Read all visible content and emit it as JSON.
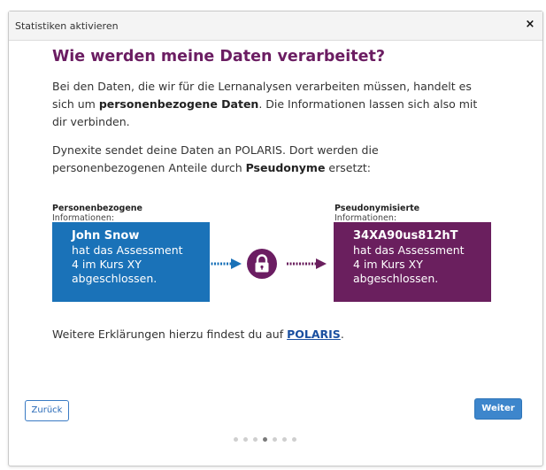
{
  "dialog": {
    "title": "Statistiken aktivieren",
    "close_symbol": "×"
  },
  "content": {
    "heading": "Wie werden meine Daten verarbeitet?",
    "p1_a": "Bei den Daten, die wir für die Lernanalysen verarbeiten müssen, handelt es sich um ",
    "p1_bold": "personenbezogene Daten",
    "p1_b": ". Die Informationen lassen sich also mit dir verbinden.",
    "p2_a": "Dynexite sendet deine Daten an POLARIS. Dort werden die personenbezogenen Anteile durch ",
    "p2_bold": "Pseudonyme",
    "p2_b": " ersetzt:",
    "p3_a": "Weitere Erklärungen hierzu findest du auf ",
    "p3_link": "POLARIS",
    "p3_b": "."
  },
  "left_box": {
    "label_line1": "Personenbezogene",
    "label_line2": "Informationen:",
    "name": "John Snow",
    "line2": "hat das Assessment",
    "line3": "4 im Kurs XY",
    "line4": "abgeschlossen."
  },
  "right_box": {
    "label_line1": "Pseudonymisierte",
    "label_line2": "Informationen:",
    "pseudonym": "34XA90us812hT",
    "line2": "hat das Assessment",
    "line3": "4 im Kurs XY",
    "line4": "abgeschlossen."
  },
  "footer": {
    "back_label": "Zurück",
    "next_label": "Weiter",
    "pager": {
      "total": 7,
      "active": 4
    }
  },
  "colors": {
    "heading": "#6b1d62",
    "blue_box": "#1a72b8",
    "purple_box": "#6a1f5e",
    "lock": "#6b1d62",
    "primary_button": "#3d86cc"
  },
  "icons": [
    "close-icon",
    "lock-icon",
    "arrow-right-icon"
  ]
}
